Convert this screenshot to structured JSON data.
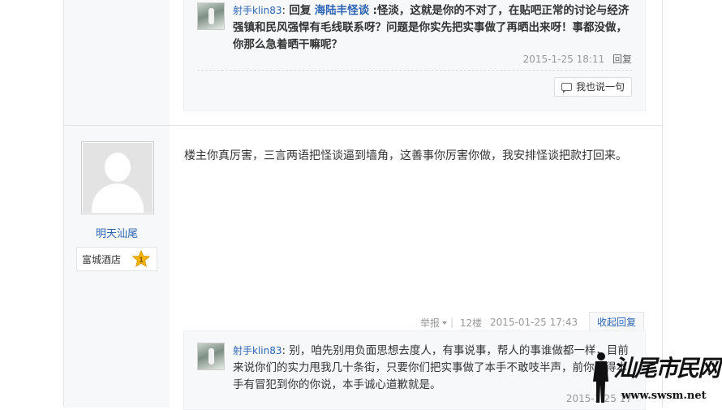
{
  "top_reply": {
    "user": "射手klin83",
    "reply_word": "回复",
    "mention": "海陆丰怪谈",
    "text": ":怪淡，这就是你的不对了，在贴吧正常的讨论与经济强镇和民风强悍有毛线联系呀？问题是你实先把实事做了再晒出来呀！事都没做，你那么急着晒干嘛呢？",
    "time": "2015-1-25 18:11",
    "reply_link": "回复",
    "say_button": "我也说一句"
  },
  "post": {
    "author": "明天汕尾",
    "badge_label": "富城酒店",
    "badge_level": "1",
    "content": "楼主你真厉害，三言两语把怪谈逼到墙角，这善事你厉害你做，我安排怪谈把款打回来。",
    "report": "举报",
    "floor": "12楼",
    "time": "2015-01-25 17:43",
    "collapse": "收起回复"
  },
  "bottom_reply": {
    "user": "射手klin83",
    "text": "别，咱先别用负面思想去度人，有事说事，帮人的事谁做都一样，目前来说你们的实力甩我几十条街，只要你们把实事做了本手不敢吱半声，前你觉得本手有冒犯到你的你说，本手诚心道歉就是。",
    "time": "2015-1-25 17"
  },
  "watermark": {
    "title": "汕尾市民网",
    "url": "www.swsm.net"
  },
  "colors": {
    "link": "#2d64b3",
    "panel": "#f7f8fa",
    "badge_star": "#f5b400"
  }
}
